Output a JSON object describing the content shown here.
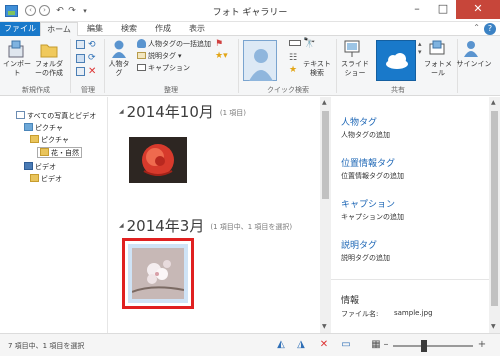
{
  "window": {
    "title": "フォト ギャラリー"
  },
  "tabs": [
    "ファイル",
    "ホーム",
    "編集",
    "検索",
    "作成",
    "表示"
  ],
  "ribbon": {
    "new_group": {
      "label": "新規作成",
      "import": "インポート",
      "new_folder": "フォルダーの作成"
    },
    "manage_group": {
      "label": "管理"
    },
    "organize_group": {
      "label": "整理",
      "people": "人物タグ",
      "batch_people": "人物タグの一括追加",
      "caption_tag": "説明タグ",
      "caption": "キャプション"
    },
    "quickfind_group": {
      "label": "クイック検索",
      "text_search": "テキスト検索"
    },
    "share_group": {
      "label": "共有",
      "slideshow": "スライドショー",
      "photo_mail": "フォトメール"
    },
    "signin": "サインイン"
  },
  "tree": [
    {
      "label": "すべての写真とビデオ",
      "icon": "root-icon"
    },
    {
      "label": "ピクチャ",
      "icon": "pictures-icon"
    },
    {
      "label": "ピクチャ",
      "icon": "folder-icon"
    },
    {
      "label": "花・自然",
      "icon": "folder-icon"
    },
    {
      "label": "ビデオ",
      "icon": "videos-icon"
    },
    {
      "label": "ビデオ",
      "icon": "folder-icon"
    }
  ],
  "groups": [
    {
      "title": "2014年10月",
      "count": "(1 項目)"
    },
    {
      "title": "2014年3月",
      "count": "(1 項目中、1 項目を選択)"
    }
  ],
  "info_pane": {
    "people_tags": {
      "heading": "人物タグ",
      "action": "人物タグの追加"
    },
    "geotags": {
      "heading": "位置情報タグ",
      "action": "位置情報タグの追加"
    },
    "caption": {
      "heading": "キャプション",
      "action": "キャプションの追加"
    },
    "description": {
      "heading": "説明タグ",
      "action": "説明タグの追加"
    },
    "information": {
      "heading": "情報",
      "filename_label": "ファイル名:",
      "filename_value": "sample.jpg"
    }
  },
  "status": {
    "text": "7 項目中、1 項目を選択"
  },
  "colors": {
    "accent": "#1979ca",
    "selection_border": "#e02020",
    "close_button": "#c7463a",
    "link_blue": "#1e67b6"
  }
}
